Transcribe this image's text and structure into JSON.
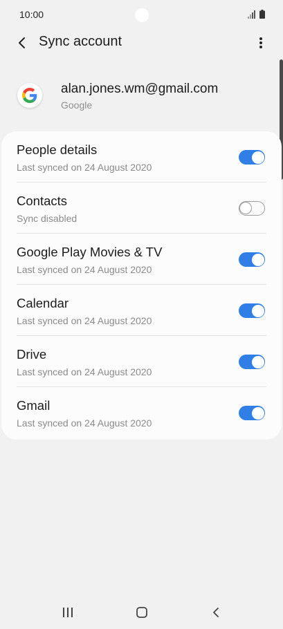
{
  "status_bar": {
    "time": "10:00",
    "icons": [
      "signal-icon",
      "battery-icon"
    ]
  },
  "app_bar": {
    "title": "Sync account",
    "back_icon": "back-arrow-icon",
    "more_icon": "more-options-icon"
  },
  "account": {
    "email": "alan.jones.wm@gmail.com",
    "type": "Google",
    "logo_icon": "google-logo-icon"
  },
  "sync_items": [
    {
      "title": "People details",
      "subtitle": "Last synced on 24 August 2020",
      "enabled": true
    },
    {
      "title": "Contacts",
      "subtitle": "Sync disabled",
      "enabled": false
    },
    {
      "title": "Google Play Movies & TV",
      "subtitle": "Last synced on 24 August 2020",
      "enabled": true
    },
    {
      "title": "Calendar",
      "subtitle": "Last synced on 24 August 2020",
      "enabled": true
    },
    {
      "title": "Drive",
      "subtitle": "Last synced on 24 August 2020",
      "enabled": true
    },
    {
      "title": "Gmail",
      "subtitle": "Last synced on 24 August 2020",
      "enabled": true
    }
  ],
  "nav_bar": {
    "icons": [
      "recent-apps-icon",
      "home-icon",
      "back-icon"
    ]
  },
  "colors": {
    "accent": "#2f7fe6",
    "background": "#f1f1f1",
    "card": "#fcfcfc"
  }
}
